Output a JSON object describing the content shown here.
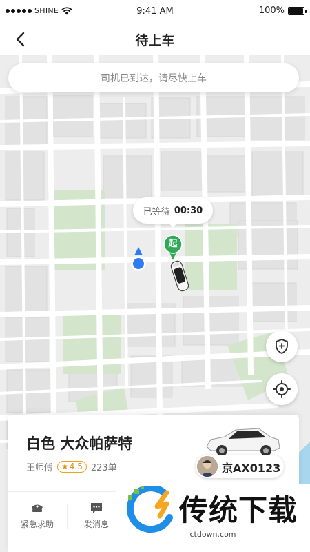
{
  "status_bar": {
    "carrier": "SHINE",
    "time": "9:41 AM",
    "battery": "100%"
  },
  "header": {
    "title": "待上车"
  },
  "map": {
    "notice": "司机已到达，请尽快上车",
    "wait_label": "已等待",
    "wait_time": "00:30",
    "pickup_label": "起",
    "colors": {
      "pickup_marker": "#2eaa55",
      "user_location": "#2d7cf6",
      "road": "#ffffff",
      "park": "#cfe4c8",
      "water": "#9ed4ef",
      "block": "#e6e6e6"
    }
  },
  "trip": {
    "car_model": "白色 大众帕萨特",
    "driver_name": "王师傅",
    "rating_star": "★",
    "rating": "4.5",
    "orders": "223单",
    "plate": "京AX0123",
    "actions": [
      {
        "label": "紧急求助",
        "icon": "police-icon"
      },
      {
        "label": "发消息",
        "icon": "message-icon"
      }
    ]
  },
  "watermark": {
    "text": "传统下载",
    "url": "ctdown.com"
  }
}
